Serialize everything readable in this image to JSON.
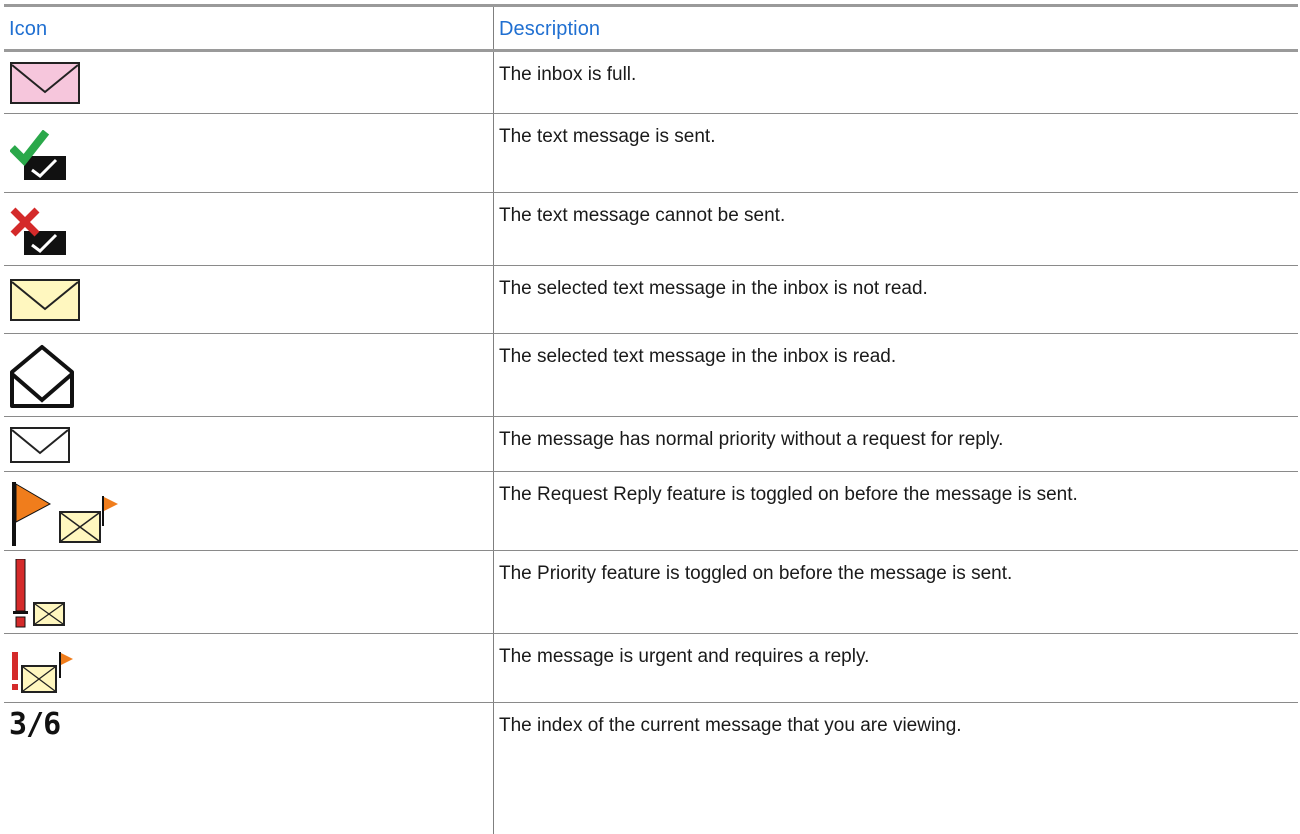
{
  "header": {
    "icon_col": "Icon",
    "desc_col": "Description"
  },
  "rows": [
    {
      "icon": "inbox-full-icon",
      "description": "The inbox is full."
    },
    {
      "icon": "message-sent-icon",
      "description": "The text message is sent."
    },
    {
      "icon": "message-failed-icon",
      "description": "The text message cannot be sent."
    },
    {
      "icon": "unread-message-icon",
      "description": "The selected text message in the inbox is not read."
    },
    {
      "icon": "read-message-icon",
      "description": "The selected text message in the inbox is read."
    },
    {
      "icon": "normal-priority-icon",
      "description": "The message has normal priority without a request for reply."
    },
    {
      "icon": "request-reply-icon",
      "description": "The Request Reply feature is toggled on before the message is sent."
    },
    {
      "icon": "priority-icon",
      "description": "The Priority feature is toggled on before the message is sent."
    },
    {
      "icon": "urgent-reply-icon",
      "description": "The message is urgent and requires a reply."
    },
    {
      "icon": "message-index",
      "index_text": "3/6",
      "description": "The index of the current message that you are viewing."
    }
  ],
  "colors": {
    "header_text": "#1f6fd1",
    "flag_orange": "#f07d1c",
    "alert_red": "#d42a2a",
    "check_green": "#2aa84a",
    "envelope_yellow": "#fff7bf",
    "envelope_pink": "#f6c6dc"
  }
}
